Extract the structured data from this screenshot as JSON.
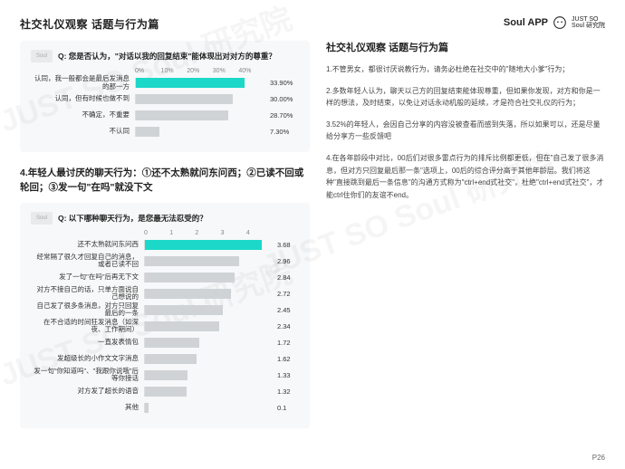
{
  "header": {
    "title": "社交礼仪观察 话题与行为篇",
    "brand": "Soul APP",
    "brand_sub1": "JUST SO",
    "brand_sub2": "Soul 研究院"
  },
  "chart_data": [
    {
      "type": "bar",
      "question": "Q: 您是否认为，\"对话以我的回复结束\"能体现出对对方的尊重？",
      "categories": [
        "认同，我一般都会是最后发消息的那一方",
        "认同，但有时候也做不到",
        "不确定，不重要",
        "不认同"
      ],
      "values": [
        33.9,
        30.0,
        28.7,
        7.3
      ],
      "value_suffix": "%",
      "xlabel": "",
      "ylabel": "",
      "xlim": [
        0,
        40
      ],
      "ticks": [
        "0%",
        "10%",
        "20%",
        "30%",
        "40%"
      ]
    },
    {
      "type": "bar",
      "question": "Q: 以下哪种聊天行为，是您最无法忍受的？",
      "categories": [
        "还不太熟就问东问西",
        "经常隔了很久才回复自己的消息，或者已读不回",
        "发了一句\"在吗\"后再无下文",
        "对方不接自己的话，只单方面说自己想说的",
        "自己发了很多条消息，对方只回复最后的一条",
        "在不合适的时间狂发消息（如深夜、工作期间）",
        "一直发表情包",
        "发超级长的小作文文字消息",
        "发一句\"你知道吗\"、\"我跟你说哦\"后等你接话",
        "对方发了超长的语音",
        "其他"
      ],
      "values": [
        3.68,
        2.96,
        2.84,
        2.72,
        2.45,
        2.34,
        1.72,
        1.62,
        1.33,
        1.32,
        0.1
      ],
      "value_suffix": "",
      "xlabel": "",
      "ylabel": "",
      "xlim": [
        0,
        4
      ],
      "ticks": [
        "0",
        "1",
        "2",
        "3",
        "4"
      ]
    }
  ],
  "left": {
    "subheading": "4.年轻人最讨厌的聊天行为：①还不太熟就问东问西；②已读不回或轮回；③发一句\"在吗\"就没下文"
  },
  "right": {
    "heading": "社交礼仪观察 话题与行为篇",
    "paras": [
      "1.不管男女，都很讨厌说教行为，请务必杜绝在社交中的\"随地大小爹\"行为；",
      "2.多数年轻人认为，聊天以己方的回复结束能体现尊重，但如果你发现，对方和你是一样的想法，及时结束，以免让对话永动机般的延续，才是符合社交礼仪的行为；",
      "3.52%的年轻人，会因自己分享的内容没被查看而感到失落，所以如果可以，还是尽量给分享方一些反馈吧",
      "4.在各年龄段中对比，00后们对很多雷点行为的排斥比例都更低，但在\"自己发了很多消息，但对方只回复最后那一条\"选项上，00后的综合评分高于其他年龄层。我们将这种\"直接跳到最后一条信息\"的沟通方式称为\"ctrl+end式社交\"，杜绝\"ctrl+end式社交\"，才能ctrl住你们的友谊不end。"
    ]
  },
  "pagenum": "P26",
  "watermark": "JUST SO Soul 研究院"
}
